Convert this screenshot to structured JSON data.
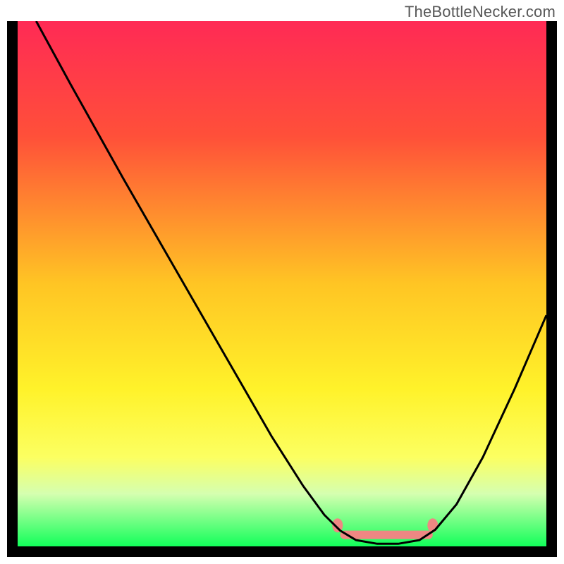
{
  "watermark": "TheBottleNecker.com",
  "chart_data": {
    "type": "line",
    "title": "",
    "xlabel": "",
    "ylabel": "",
    "xlim": [
      0,
      100
    ],
    "ylim": [
      0,
      100
    ],
    "gradient_stops": [
      {
        "offset": 0,
        "color": "#ff2a55"
      },
      {
        "offset": 22,
        "color": "#ff5039"
      },
      {
        "offset": 50,
        "color": "#ffc524"
      },
      {
        "offset": 70,
        "color": "#fff22a"
      },
      {
        "offset": 83,
        "color": "#fcff61"
      },
      {
        "offset": 90,
        "color": "#d5ffb0"
      },
      {
        "offset": 100,
        "color": "#12ff5a"
      }
    ],
    "series": [
      {
        "name": "bottleneck-curve",
        "color": "#000000",
        "points": [
          {
            "x": 3.5,
            "y": 100.0
          },
          {
            "x": 10.0,
            "y": 88.0
          },
          {
            "x": 20.0,
            "y": 70.0
          },
          {
            "x": 30.0,
            "y": 52.5
          },
          {
            "x": 40.0,
            "y": 35.0
          },
          {
            "x": 48.0,
            "y": 21.0
          },
          {
            "x": 54.0,
            "y": 11.5
          },
          {
            "x": 58.0,
            "y": 6.0
          },
          {
            "x": 61.0,
            "y": 3.0
          },
          {
            "x": 64.0,
            "y": 1.2
          },
          {
            "x": 68.0,
            "y": 0.5
          },
          {
            "x": 72.0,
            "y": 0.5
          },
          {
            "x": 76.0,
            "y": 1.2
          },
          {
            "x": 79.0,
            "y": 3.2
          },
          {
            "x": 83.0,
            "y": 8.0
          },
          {
            "x": 88.0,
            "y": 17.0
          },
          {
            "x": 94.0,
            "y": 30.0
          },
          {
            "x": 100.0,
            "y": 44.0
          }
        ]
      }
    ],
    "optimal_band": {
      "color": "#ef8783",
      "segments": [
        {
          "x1": 59.5,
          "x2": 61.5,
          "y": 4.0
        },
        {
          "x1": 61.0,
          "x2": 78.5,
          "y": 2.2
        },
        {
          "x1": 77.5,
          "x2": 79.5,
          "y": 4.0
        }
      ]
    }
  }
}
